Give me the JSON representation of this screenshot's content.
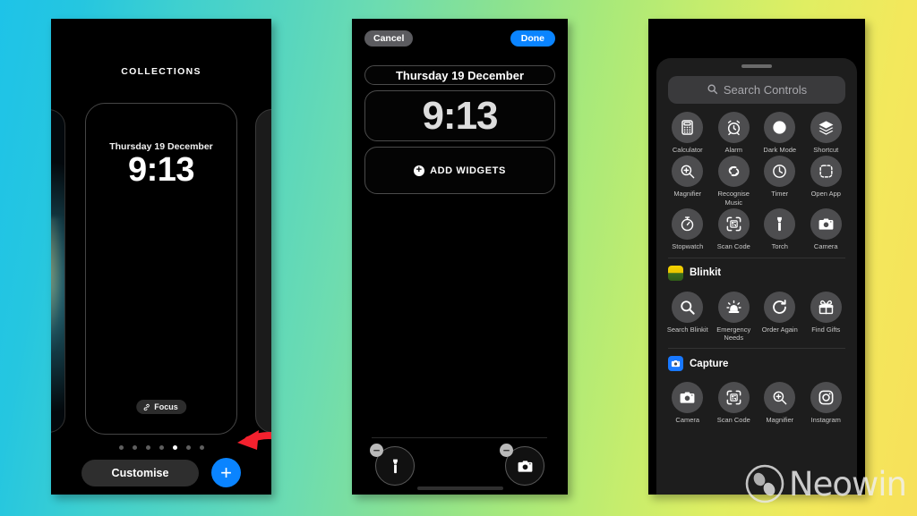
{
  "background": {
    "gradient_from": "#1ec3e8",
    "gradient_mid": "#8ce28f",
    "gradient_to": "#f7e05a"
  },
  "accent": {
    "blue": "#0a84ff",
    "arrow_red": "#f4212e"
  },
  "phone1": {
    "header": "COLLECTIONS",
    "wallpaper_card": {
      "date": "Thursday 19 December",
      "time": "9:13",
      "focus_label": "Focus"
    },
    "page_dots": {
      "count": 7,
      "active_index": 4
    },
    "customise_label": "Customise",
    "add_label": "+"
  },
  "phone2": {
    "cancel_label": "Cancel",
    "done_label": "Done",
    "date_field": "Thursday 19 December",
    "time_field": "9:13",
    "add_widgets_label": "ADD WIDGETS",
    "quick_controls": [
      {
        "name": "Torch",
        "icon": "torch-icon",
        "remove": "−"
      },
      {
        "name": "Camera",
        "icon": "camera-icon",
        "remove": "−"
      }
    ]
  },
  "phone3": {
    "search_placeholder": "Search Controls",
    "sections": [
      {
        "title": "",
        "app_icon": "",
        "controls": [
          {
            "label": "Calculator",
            "icon": "calculator-icon"
          },
          {
            "label": "Alarm",
            "icon": "alarm-icon"
          },
          {
            "label": "Dark Mode",
            "icon": "dark-mode-icon"
          },
          {
            "label": "Shortcut",
            "icon": "shortcut-icon"
          },
          {
            "label": "Magnifier",
            "icon": "magnifier-icon"
          },
          {
            "label": "Recognise Music",
            "icon": "shazam-icon"
          },
          {
            "label": "Timer",
            "icon": "timer-icon"
          },
          {
            "label": "Open App",
            "icon": "open-app-icon"
          },
          {
            "label": "Stopwatch",
            "icon": "stopwatch-icon"
          },
          {
            "label": "Scan Code",
            "icon": "scan-code-icon"
          },
          {
            "label": "Torch",
            "icon": "torch-icon"
          },
          {
            "label": "Camera",
            "icon": "camera-icon"
          }
        ]
      },
      {
        "title": "Blinkit",
        "app_icon": "blinkit-app-icon",
        "controls": [
          {
            "label": "Search Blinkit",
            "icon": "search-icon"
          },
          {
            "label": "Emergency Needs",
            "icon": "siren-icon"
          },
          {
            "label": "Order Again",
            "icon": "reorder-icon"
          },
          {
            "label": "Find Gifts",
            "icon": "gift-icon"
          }
        ]
      },
      {
        "title": "Capture",
        "app_icon": "capture-app-icon",
        "controls": [
          {
            "label": "Camera",
            "icon": "camera-icon"
          },
          {
            "label": "Scan Code",
            "icon": "scan-code-icon"
          },
          {
            "label": "Magnifier",
            "icon": "magnifier-icon"
          },
          {
            "label": "Instagram",
            "icon": "instagram-icon"
          }
        ]
      }
    ]
  },
  "watermark": {
    "text": "Neowin"
  }
}
